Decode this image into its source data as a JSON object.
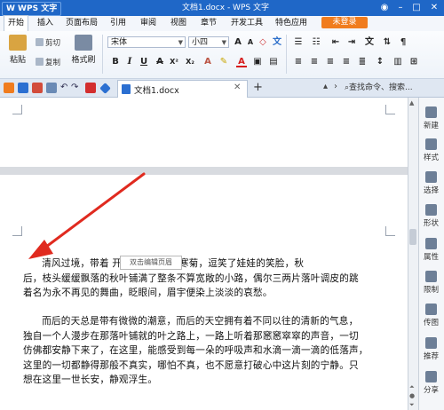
{
  "titlebar": {
    "app_label": "W WPS 文字",
    "title": "文档1.docx - WPS 文字"
  },
  "menu": {
    "tabs": [
      "开始",
      "插入",
      "页面布局",
      "引用",
      "审阅",
      "视图",
      "章节",
      "开发工具",
      "特色应用"
    ],
    "login": "未登录"
  },
  "ribbon": {
    "paste": "粘贴",
    "cut": "剪切",
    "copy": "复制",
    "format_painter": "格式刷",
    "font_name": "宋体",
    "font_size": "小四",
    "bold": "B",
    "italic": "I",
    "underline": "U",
    "font_color": "A"
  },
  "docbar": {
    "doc_tab": "文档1.docx",
    "add_tab": "+",
    "search": "查找命令、搜索..."
  },
  "document": {
    "tooltip": "双击编辑页眉",
    "paragraph1_lines": [
      "清风过境，带着    开了将绽未绽的寒菊，逗笑了娃娃的笑脸，秋",
      "后，枝头缓缓飘落的秋叶铺满了整条不算宽敞的小路，偶尔三两片落叶调皮的跳",
      "着名为永不再见的舞曲，眨眼间，眉宇便染上淡淡的哀愁。"
    ],
    "paragraph2_lines": [
      "而后的天总是带有微微的潮意，而后的天空拥有着不同以往的清新的气息，",
      "独自一个人漫步在那落叶铺就的叶之路上，一路上听着那窸窸窣窣的声音，一切",
      "仿佛都安静下来了，在这里，能感受到每一朵的呼吸声和水滴一滴一滴的低落声，",
      "这里的一切都静得那般不真实，哪怕不真，也不愿意打破心中这片刻的宁静。只",
      "想在这里一世长安，静观浮生。"
    ]
  },
  "right_pane": {
    "items": [
      "新建",
      "样式",
      "选择",
      "形状",
      "属性",
      "限制",
      "传图",
      "推荐",
      "分享"
    ]
  },
  "colors": {
    "title_blue": "#1f67c7",
    "login_orange": "#f07c1e",
    "arrow_red": "#e02a1f"
  }
}
